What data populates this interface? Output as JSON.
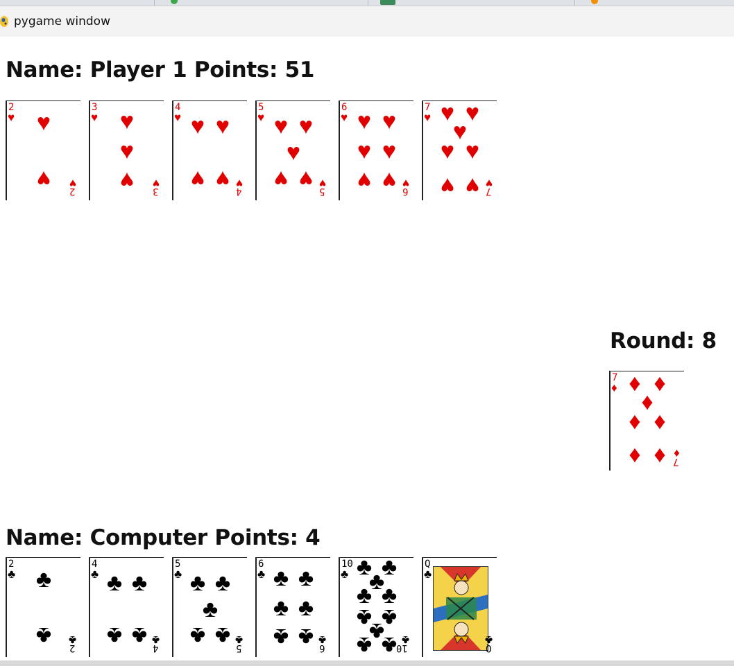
{
  "window": {
    "title": "pygame window",
    "app_icon": "pygame-snake-icon"
  },
  "player": {
    "name_label": "Name: Player 1 Points: 51",
    "hand": [
      {
        "rank": "2",
        "suit": "hearts",
        "symbol": "♥",
        "color": "#e00000"
      },
      {
        "rank": "3",
        "suit": "hearts",
        "symbol": "♥",
        "color": "#e00000"
      },
      {
        "rank": "4",
        "suit": "hearts",
        "symbol": "♥",
        "color": "#e00000"
      },
      {
        "rank": "5",
        "suit": "hearts",
        "symbol": "♥",
        "color": "#e00000"
      },
      {
        "rank": "6",
        "suit": "hearts",
        "symbol": "♥",
        "color": "#e00000"
      },
      {
        "rank": "7",
        "suit": "hearts",
        "symbol": "♥",
        "color": "#e00000"
      }
    ]
  },
  "round": {
    "label": "Round: 8",
    "card": {
      "rank": "7",
      "suit": "diamonds",
      "symbol": "♦",
      "color": "#e00000"
    }
  },
  "computer": {
    "name_label": "Name: Computer Points: 4",
    "hand": [
      {
        "rank": "2",
        "suit": "clubs",
        "symbol": "♣",
        "color": "#000000"
      },
      {
        "rank": "4",
        "suit": "clubs",
        "symbol": "♣",
        "color": "#000000"
      },
      {
        "rank": "5",
        "suit": "clubs",
        "symbol": "♣",
        "color": "#000000"
      },
      {
        "rank": "6",
        "suit": "clubs",
        "symbol": "♣",
        "color": "#000000"
      },
      {
        "rank": "10",
        "suit": "clubs",
        "symbol": "♣",
        "color": "#000000"
      },
      {
        "rank": "Q",
        "suit": "clubs",
        "symbol": "♣",
        "color": "#000000"
      }
    ]
  }
}
